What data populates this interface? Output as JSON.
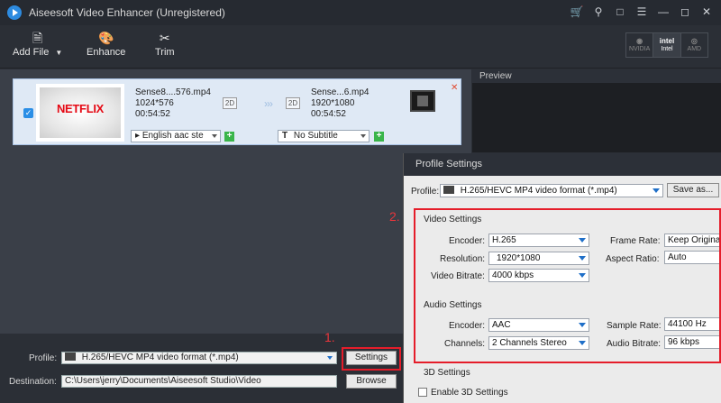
{
  "app": {
    "title": "Aiseesoft Video Enhancer (Unregistered)"
  },
  "title_icons": [
    "cart-icon",
    "key-icon",
    "feedback-icon",
    "menu-icon",
    "minimize-icon",
    "maximize-icon",
    "close-icon"
  ],
  "toolbar": {
    "add_file": "Add File",
    "enhance": "Enhance",
    "trim": "Trim",
    "hw": [
      {
        "name": "NVIDIA",
        "active": false
      },
      {
        "name": "Intel",
        "active": true
      },
      {
        "name": "AMD",
        "active": false
      }
    ]
  },
  "file": {
    "thumb_text": "NETFLIX",
    "src_name": "Sense8....576.mp4",
    "src_res": "1024*576",
    "src_dur": "00:54:52",
    "badge": "2D",
    "dst_name": "Sense...6.mp4",
    "dst_res": "1920*1080",
    "dst_dur": "00:54:52",
    "audio": "English aac ste",
    "subtitle": "No Subtitle",
    "arrows": "›››"
  },
  "preview": {
    "title": "Preview"
  },
  "bottom": {
    "profile_label": "Profile:",
    "profile_value": "H.265/HEVC MP4 video format (*.mp4)",
    "settings_btn": "Settings",
    "destination_label": "Destination:",
    "destination_value": "C:\\Users\\jerry\\Documents\\Aiseesoft Studio\\Video",
    "browse_btn": "Browse"
  },
  "annotations": {
    "one": "1.",
    "two": "2."
  },
  "dialog": {
    "title": "Profile Settings",
    "profile_label": "Profile:",
    "profile_value": "H.265/HEVC MP4 video format (*.mp4)",
    "save_as": "Save as...",
    "video_settings": "Video Settings",
    "encoder_label": "Encoder:",
    "encoder_value": "H.265",
    "resolution_label": "Resolution:",
    "resolution_value": "1920*1080",
    "video_bitrate_label": "Video Bitrate:",
    "video_bitrate_value": "4000 kbps",
    "frame_rate_label": "Frame Rate:",
    "frame_rate_value": "Keep Origina",
    "aspect_ratio_label": "Aspect Ratio:",
    "aspect_ratio_value": "Auto",
    "audio_settings": "Audio Settings",
    "audio_encoder_label": "Encoder:",
    "audio_encoder_value": "AAC",
    "channels_label": "Channels:",
    "channels_value": "2 Channels Stereo",
    "sample_rate_label": "Sample Rate:",
    "sample_rate_value": "44100 Hz",
    "audio_bitrate_label": "Audio Bitrate:",
    "audio_bitrate_value": "96 kbps",
    "settings_3d": "3D Settings",
    "enable_3d": "Enable 3D Settings"
  },
  "colors": {
    "accent": "#2a8ee6",
    "annotation": "#e51d2a",
    "netflix": "#e50914"
  }
}
